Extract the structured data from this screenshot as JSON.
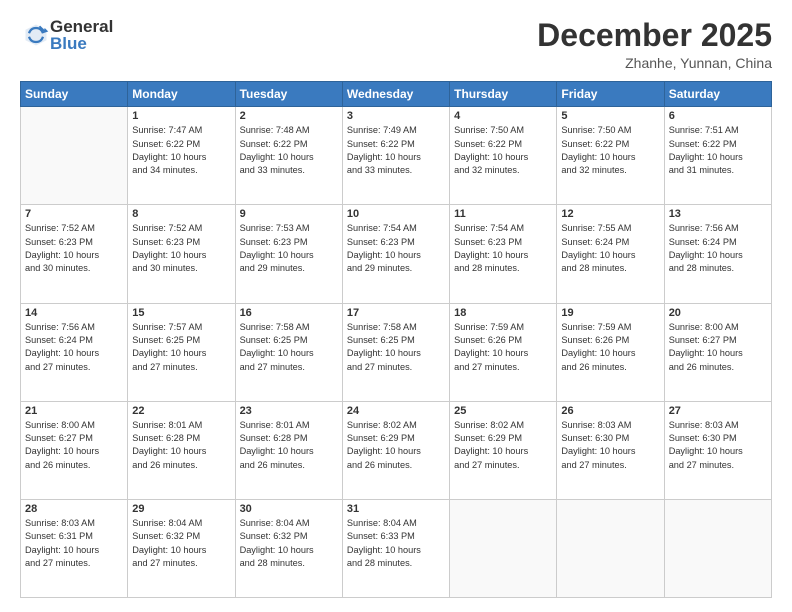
{
  "header": {
    "logo_general": "General",
    "logo_blue": "Blue",
    "month": "December 2025",
    "location": "Zhanhe, Yunnan, China"
  },
  "days_of_week": [
    "Sunday",
    "Monday",
    "Tuesday",
    "Wednesday",
    "Thursday",
    "Friday",
    "Saturday"
  ],
  "weeks": [
    [
      {
        "day": "",
        "info": ""
      },
      {
        "day": "1",
        "info": "Sunrise: 7:47 AM\nSunset: 6:22 PM\nDaylight: 10 hours\nand 34 minutes."
      },
      {
        "day": "2",
        "info": "Sunrise: 7:48 AM\nSunset: 6:22 PM\nDaylight: 10 hours\nand 33 minutes."
      },
      {
        "day": "3",
        "info": "Sunrise: 7:49 AM\nSunset: 6:22 PM\nDaylight: 10 hours\nand 33 minutes."
      },
      {
        "day": "4",
        "info": "Sunrise: 7:50 AM\nSunset: 6:22 PM\nDaylight: 10 hours\nand 32 minutes."
      },
      {
        "day": "5",
        "info": "Sunrise: 7:50 AM\nSunset: 6:22 PM\nDaylight: 10 hours\nand 32 minutes."
      },
      {
        "day": "6",
        "info": "Sunrise: 7:51 AM\nSunset: 6:22 PM\nDaylight: 10 hours\nand 31 minutes."
      }
    ],
    [
      {
        "day": "7",
        "info": "Sunrise: 7:52 AM\nSunset: 6:23 PM\nDaylight: 10 hours\nand 30 minutes."
      },
      {
        "day": "8",
        "info": "Sunrise: 7:52 AM\nSunset: 6:23 PM\nDaylight: 10 hours\nand 30 minutes."
      },
      {
        "day": "9",
        "info": "Sunrise: 7:53 AM\nSunset: 6:23 PM\nDaylight: 10 hours\nand 29 minutes."
      },
      {
        "day": "10",
        "info": "Sunrise: 7:54 AM\nSunset: 6:23 PM\nDaylight: 10 hours\nand 29 minutes."
      },
      {
        "day": "11",
        "info": "Sunrise: 7:54 AM\nSunset: 6:23 PM\nDaylight: 10 hours\nand 28 minutes."
      },
      {
        "day": "12",
        "info": "Sunrise: 7:55 AM\nSunset: 6:24 PM\nDaylight: 10 hours\nand 28 minutes."
      },
      {
        "day": "13",
        "info": "Sunrise: 7:56 AM\nSunset: 6:24 PM\nDaylight: 10 hours\nand 28 minutes."
      }
    ],
    [
      {
        "day": "14",
        "info": "Sunrise: 7:56 AM\nSunset: 6:24 PM\nDaylight: 10 hours\nand 27 minutes."
      },
      {
        "day": "15",
        "info": "Sunrise: 7:57 AM\nSunset: 6:25 PM\nDaylight: 10 hours\nand 27 minutes."
      },
      {
        "day": "16",
        "info": "Sunrise: 7:58 AM\nSunset: 6:25 PM\nDaylight: 10 hours\nand 27 minutes."
      },
      {
        "day": "17",
        "info": "Sunrise: 7:58 AM\nSunset: 6:25 PM\nDaylight: 10 hours\nand 27 minutes."
      },
      {
        "day": "18",
        "info": "Sunrise: 7:59 AM\nSunset: 6:26 PM\nDaylight: 10 hours\nand 27 minutes."
      },
      {
        "day": "19",
        "info": "Sunrise: 7:59 AM\nSunset: 6:26 PM\nDaylight: 10 hours\nand 26 minutes."
      },
      {
        "day": "20",
        "info": "Sunrise: 8:00 AM\nSunset: 6:27 PM\nDaylight: 10 hours\nand 26 minutes."
      }
    ],
    [
      {
        "day": "21",
        "info": "Sunrise: 8:00 AM\nSunset: 6:27 PM\nDaylight: 10 hours\nand 26 minutes."
      },
      {
        "day": "22",
        "info": "Sunrise: 8:01 AM\nSunset: 6:28 PM\nDaylight: 10 hours\nand 26 minutes."
      },
      {
        "day": "23",
        "info": "Sunrise: 8:01 AM\nSunset: 6:28 PM\nDaylight: 10 hours\nand 26 minutes."
      },
      {
        "day": "24",
        "info": "Sunrise: 8:02 AM\nSunset: 6:29 PM\nDaylight: 10 hours\nand 26 minutes."
      },
      {
        "day": "25",
        "info": "Sunrise: 8:02 AM\nSunset: 6:29 PM\nDaylight: 10 hours\nand 27 minutes."
      },
      {
        "day": "26",
        "info": "Sunrise: 8:03 AM\nSunset: 6:30 PM\nDaylight: 10 hours\nand 27 minutes."
      },
      {
        "day": "27",
        "info": "Sunrise: 8:03 AM\nSunset: 6:30 PM\nDaylight: 10 hours\nand 27 minutes."
      }
    ],
    [
      {
        "day": "28",
        "info": "Sunrise: 8:03 AM\nSunset: 6:31 PM\nDaylight: 10 hours\nand 27 minutes."
      },
      {
        "day": "29",
        "info": "Sunrise: 8:04 AM\nSunset: 6:32 PM\nDaylight: 10 hours\nand 27 minutes."
      },
      {
        "day": "30",
        "info": "Sunrise: 8:04 AM\nSunset: 6:32 PM\nDaylight: 10 hours\nand 28 minutes."
      },
      {
        "day": "31",
        "info": "Sunrise: 8:04 AM\nSunset: 6:33 PM\nDaylight: 10 hours\nand 28 minutes."
      },
      {
        "day": "",
        "info": ""
      },
      {
        "day": "",
        "info": ""
      },
      {
        "day": "",
        "info": ""
      }
    ]
  ]
}
